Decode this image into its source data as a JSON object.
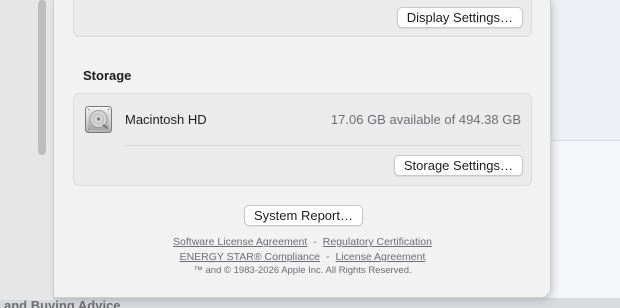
{
  "display": {
    "settings_button": "Display Settings…"
  },
  "storage": {
    "section_title": "Storage",
    "disk_name": "Macintosh HD",
    "available": "17.06 GB available of 494.38 GB",
    "settings_button": "Storage Settings…",
    "disk_icon": "hard-drive-icon"
  },
  "report_button": "System Report…",
  "footer": {
    "line1": [
      "Software License Agreement",
      "Regulatory Certification"
    ],
    "line2": [
      "ENERGY STAR® Compliance",
      "License Agreement"
    ],
    "separator": "-",
    "copyright": "™ and © 1983-2026 Apple Inc. All Rights Reserved."
  },
  "background": {
    "partial_heading": "and Buying Advice"
  }
}
